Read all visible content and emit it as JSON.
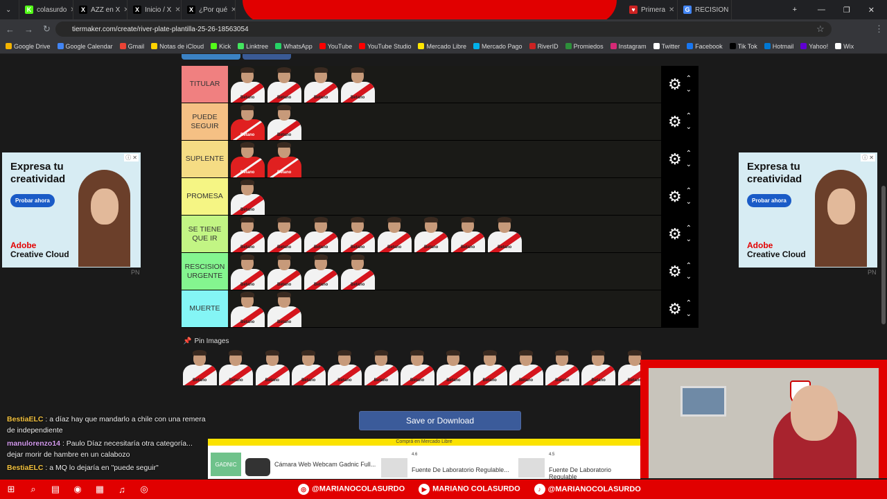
{
  "tabs": [
    {
      "label": "colasurdo",
      "color": "#53fc18",
      "glyph": "K"
    },
    {
      "label": "AZZ en X",
      "color": "#000000",
      "glyph": "X"
    },
    {
      "label": "Inicio / X",
      "color": "#000000",
      "glyph": "X"
    },
    {
      "label": "¿Por qué",
      "color": "#000000",
      "glyph": "X"
    },
    {
      "label": "Primera",
      "color": "#cc2222",
      "glyph": "♥"
    },
    {
      "label": "RECISION",
      "color": "#4285f4",
      "glyph": "G"
    }
  ],
  "address": {
    "url": "tiermaker.com/create/river-plate-plantilla-25-26-18563054"
  },
  "bookmarks": [
    "Google Drive",
    "Google Calendar",
    "Gmail",
    "Notas de iCloud",
    "Kick",
    "Linktree",
    "WhatsApp",
    "YouTube",
    "YouTube Studio",
    "Mercado Libre",
    "Mercado Pago",
    "RiverID",
    "Promiedos",
    "Instagram",
    "Twitter",
    "Facebook",
    "Tik Tok",
    "Hotmail",
    "Yahoo!",
    "Wix"
  ],
  "tiers": [
    {
      "label": "TITULAR",
      "color": "#f08080",
      "players": [
        "w",
        "w",
        "w",
        "w"
      ]
    },
    {
      "label": "PUEDE SEGUIR",
      "color": "#f5c084",
      "players": [
        "gk",
        "w"
      ]
    },
    {
      "label": "SUPLENTE",
      "color": "#f5dc84",
      "players": [
        "gk",
        "gk"
      ]
    },
    {
      "label": "PROMESA",
      "color": "#f5f584",
      "players": [
        "w"
      ]
    },
    {
      "label": "SE TIENE QUE IR",
      "color": "#c2f584",
      "players": [
        "w",
        "w",
        "w",
        "w",
        "w",
        "w",
        "w",
        "w"
      ]
    },
    {
      "label": "RESCISION URGENTE",
      "color": "#84f58f",
      "players": [
        "w",
        "w",
        "w",
        "w"
      ]
    },
    {
      "label": "MUERTE",
      "color": "#84f5f5",
      "players": [
        "w",
        "w"
      ]
    }
  ],
  "pin_label": "Pin Images",
  "save_label": "Save or Download",
  "ad": {
    "headline": "Expresa tu creatividad",
    "cta": "Probar ahora",
    "brand1": "Adobe",
    "brand2": "Creative Cloud",
    "badge": "PN"
  },
  "chat": [
    {
      "user": "BestiaELC",
      "text": " : a díaz hay que mandarlo a chile con una remera de independiente"
    },
    {
      "user": "manulorenzo14",
      "text": " : Paulo Díaz necesitaría otra categoría... dejar morir de hambre en un calabozo"
    },
    {
      "user": "BestiaELC",
      "text": " : a MQ lo dejaría en \"puede seguir\""
    }
  ],
  "ml": {
    "top": "Comprá en Mercado Libre",
    "p1": "Cámara Web Webcam Gadnic Full...",
    "p2": "Fuente De Laboratorio Regulable...",
    "p3": "Fuente De Laboratorio Regulable",
    "brand": "GADNIC",
    "r1": "4.6",
    "r2": "4.5"
  },
  "socials": [
    "@MARIANOCOLASURDO",
    "MARIANO COLASURDO",
    "@MARIANOCOLASURDO"
  ]
}
